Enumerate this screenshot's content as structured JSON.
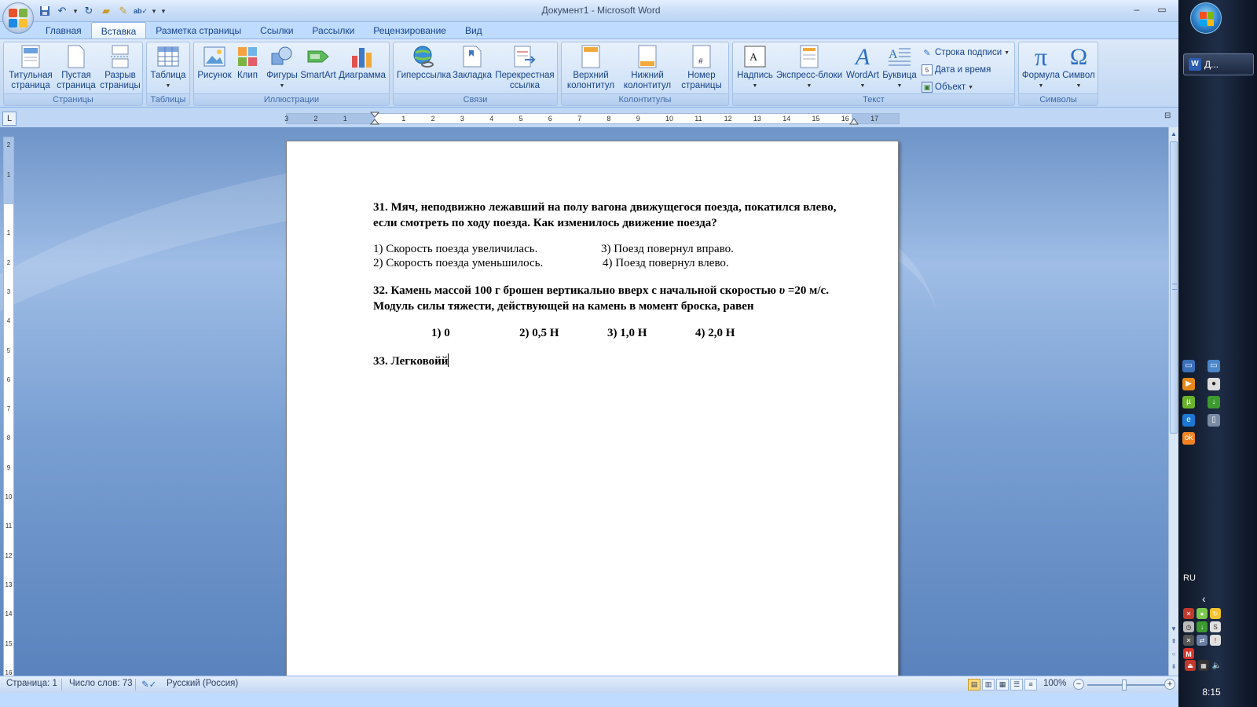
{
  "window": {
    "title": "Документ1 - Microsoft Word",
    "controls": {
      "minimize": "–",
      "maximize": "▭",
      "close": "✕"
    }
  },
  "qat": {
    "customize": "▾"
  },
  "tabs": [
    {
      "label": "Главная"
    },
    {
      "label": "Вставка",
      "active": true
    },
    {
      "label": "Разметка страницы"
    },
    {
      "label": "Ссылки"
    },
    {
      "label": "Рассылки"
    },
    {
      "label": "Рецензирование"
    },
    {
      "label": "Вид"
    }
  ],
  "help": "?",
  "ribbon": {
    "pages": {
      "label": "Страницы",
      "cover": "Титульная\nстраница",
      "blank": "Пустая\nстраница",
      "break": "Разрыв\nстраницы"
    },
    "tables": {
      "label": "Таблицы",
      "table": "Таблица"
    },
    "illustrations": {
      "label": "Иллюстрации",
      "picture": "Рисунок",
      "clip": "Клип",
      "shapes": "Фигуры",
      "smartart": "SmartArt",
      "chart": "Диаграмма"
    },
    "links": {
      "label": "Связи",
      "hyperlink": "Гиперссылка",
      "bookmark": "Закладка",
      "crossref": "Перекрестная\nссылка"
    },
    "headers": {
      "label": "Колонтитулы",
      "header": "Верхний\nколонтитул",
      "footer": "Нижний\nколонтитул",
      "pagenum": "Номер\nстраницы"
    },
    "text": {
      "label": "Текст",
      "textbox": "Надпись",
      "quickparts": "Экспресс-блоки",
      "wordart": "WordArt",
      "dropcap": "Буквица",
      "signature": "Строка подписи",
      "datetime": "Дата и время",
      "object": "Объект"
    },
    "symbols": {
      "label": "Символы",
      "equation": "Формула",
      "symbol": "Символ"
    }
  },
  "ruler": {
    "numbers": [
      "3",
      "2",
      "1",
      "1",
      "2",
      "3",
      "4",
      "5",
      "6",
      "7",
      "8",
      "9",
      "10",
      "11",
      "12",
      "13",
      "14",
      "15",
      "16",
      "17"
    ],
    "vnumbers": [
      "2",
      "1",
      "1",
      "2",
      "3",
      "4",
      "5",
      "6",
      "7",
      "8",
      "9",
      "10",
      "11",
      "12",
      "13",
      "14",
      "15",
      "16"
    ]
  },
  "document": {
    "q31": {
      "title": "31. Мяч, неподвижно лежавший на  полу вагона движущегося поезда, покатился влево, если смотреть по ходу поезда. Как изменилось движение поезда?",
      "options": [
        "1) Скорость поезда увеличилась.",
        "3) Поезд повернул вправо.",
        "2) Скорость поезда уменьшилось.",
        "4) Поезд повернул влево."
      ]
    },
    "q32": {
      "title_part1": "32. Камень массой 100 г брошен вертикально вверх с начальной скоростью ",
      "title_v": "υ",
      "title_part2": " =20 м/с. Модуль силы тяжести, действующей на камень в момент броска, равен",
      "options": [
        "1)  0",
        "2)  0,5 Н",
        "3)  1,0 Н",
        "4)  2,0 Н"
      ]
    },
    "q33": {
      "title": "33. Легковойй"
    }
  },
  "status": {
    "page": "Страница: 1",
    "words": "Число слов: 73",
    "language": "Русский (Россия)",
    "zoom": "100%",
    "zoom_minus": "−",
    "zoom_plus": "+"
  },
  "taskbar": {
    "word_task": "Д...",
    "language": "RU",
    "clock": "8:15"
  }
}
